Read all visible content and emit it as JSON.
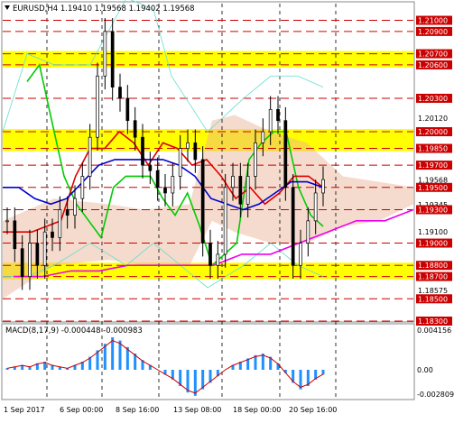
{
  "price_panel": {
    "symbol_line": "EURUSD,H4  1.19410 1.19568 1.19402 1.19568",
    "y_axis_labels": [
      "1.21000",
      "1.20900",
      "1.20700",
      "1.20600",
      "1.20300",
      "1.20120",
      "1.20000",
      "1.19850",
      "1.19700",
      "1.19568",
      "1.19500",
      "1.19345",
      "1.19300",
      "1.19100",
      "1.19000",
      "1.18800",
      "1.18700",
      "1.18575",
      "1.18500",
      "1.18300"
    ],
    "highlight_levels": [
      "1.21000",
      "1.20900",
      "1.20700",
      "1.20600",
      "1.20300",
      "1.20000",
      "1.19850",
      "1.19700",
      "1.19500",
      "1.19300",
      "1.19000",
      "1.18800",
      "1.18700",
      "1.18500",
      "1.18300"
    ],
    "current_price": "1.19568"
  },
  "macd_panel": {
    "title": "MACD(8,17,9) -0.000448 -0.000983",
    "y_axis_labels": [
      "0.004156",
      "0.00",
      "-0.002809"
    ]
  },
  "time_axis": {
    "labels": [
      "1 Sep 2017",
      "6 Sep 00:00",
      "8 Sep 16:00",
      "13 Sep 08:00",
      "18 Sep 00:00",
      "20 Sep 16:00"
    ]
  },
  "colors": {
    "bullish_candle": "#000000",
    "fast_ma": "#00cc00",
    "mid_ma": "#dd0000",
    "slow_ma": "#0000cc",
    "long_ma": "#ee00ee",
    "band": "#66ddcc",
    "level_line": "#cc0000",
    "highlight_zone": "#ffff00",
    "cloud": "#e8b090",
    "macd_hist": "#1e90ff",
    "macd_signal": "#cc0000"
  },
  "chart_data": {
    "type": "line",
    "title": "EURUSD,H4",
    "x_ticks": [
      "1 Sep 2017",
      "6 Sep 00:00",
      "8 Sep 16:00",
      "13 Sep 08:00",
      "18 Sep 00:00",
      "20 Sep 16:00"
    ],
    "ylim": [
      1.183,
      1.2115
    ],
    "ohlc_close_approx": [
      1.192,
      1.1895,
      1.187,
      1.19,
      1.188,
      1.191,
      1.1905,
      1.193,
      1.1925,
      1.194,
      1.196,
      1.1995,
      1.205,
      1.209,
      1.204,
      1.203,
      1.201,
      1.1995,
      1.197,
      1.1965,
      1.195,
      1.1945,
      1.196,
      1.1985,
      1.199,
      1.1975,
      1.19,
      1.188,
      1.189,
      1.195,
      1.196,
      1.1935,
      1.196,
      1.199,
      1.2,
      1.202,
      1.201,
      1.195,
      1.188,
      1.19,
      1.192,
      1.1945,
      1.1957
    ],
    "series": [
      {
        "name": "fast_ma",
        "values": [
          1.2045,
          1.206,
          1.201,
          1.196,
          1.1935,
          1.192,
          1.1905,
          1.195,
          1.196,
          1.196,
          1.196,
          1.194,
          1.1925,
          1.1945,
          1.1915,
          1.188,
          1.189,
          1.19,
          1.1975,
          1.199,
          1.2,
          1.2,
          1.195,
          1.1925,
          1.1915
        ]
      },
      {
        "name": "mid_ma",
        "values": [
          1.191,
          1.191,
          1.191,
          1.1915,
          1.192,
          1.196,
          1.1985,
          1.1985,
          1.2,
          1.199,
          1.197,
          1.199,
          1.1985,
          1.197,
          1.1975,
          1.196,
          1.194,
          1.195,
          1.1935,
          1.1945,
          1.196,
          1.196,
          1.195
        ]
      },
      {
        "name": "slow_ma",
        "values": [
          1.195,
          1.195,
          1.194,
          1.1935,
          1.194,
          1.1955,
          1.197,
          1.1975,
          1.1975,
          1.1975,
          1.1975,
          1.197,
          1.196,
          1.194,
          1.1935,
          1.193,
          1.1935,
          1.1945,
          1.1955,
          1.1955,
          1.195
        ]
      },
      {
        "name": "long_ma",
        "values": [
          1.187,
          1.187,
          1.1875,
          1.1875,
          1.188,
          1.188,
          1.188,
          1.188,
          1.189,
          1.189,
          1.19,
          1.191,
          1.192,
          1.192,
          1.193
        ]
      }
    ]
  }
}
